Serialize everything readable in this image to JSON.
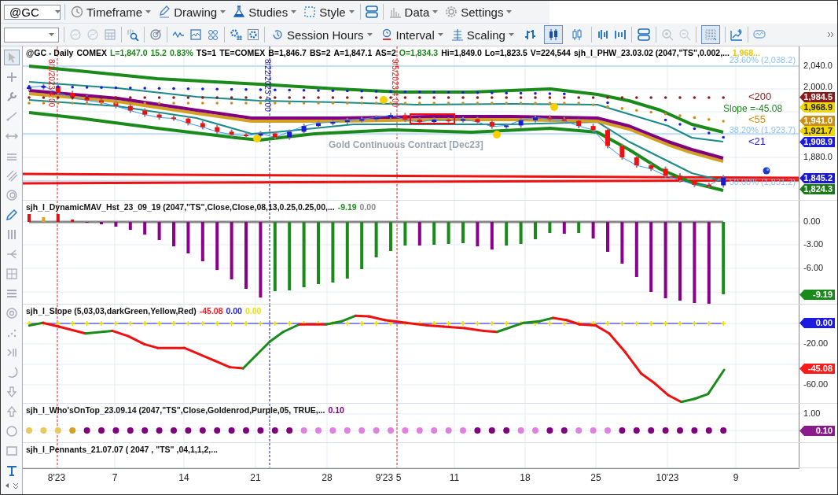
{
  "toolbar_1": {
    "symbol": "@GC",
    "menus": [
      {
        "label": "Timeframe"
      },
      {
        "label": "Drawing"
      },
      {
        "label": "Studies"
      },
      {
        "label": "Style"
      },
      {
        "label": "Data"
      },
      {
        "label": "Settings"
      }
    ]
  },
  "toolbar_2": {
    "menus": [
      {
        "label": "Session Hours"
      },
      {
        "label": "Interval"
      },
      {
        "label": "Scaling"
      }
    ],
    "chart_styles": [
      {
        "selected": false
      },
      {
        "selected": true
      },
      {
        "selected": false
      }
    ],
    "grid": {
      "on": true
    }
  },
  "tools": [
    {
      "selected": true
    },
    {
      "selected": false
    },
    {
      "selected": false
    },
    {
      "selected": false
    },
    {
      "selected": false
    },
    {
      "selected": false
    },
    {
      "selected": false
    },
    {
      "selected": false
    },
    {
      "selected": false
    },
    {
      "selected": false
    },
    {
      "selected": false
    },
    {
      "selected": false
    },
    {
      "selected": false
    },
    {
      "selected": false
    },
    {
      "selected": false
    },
    {
      "selected": false
    },
    {
      "selected": false
    },
    {
      "selected": false
    },
    {
      "selected": false
    },
    {
      "selected": false
    },
    {
      "selected": false
    },
    {
      "selected": false
    }
  ],
  "price_pane": {
    "header": [
      {
        "text": "@GC - Daily",
        "color": "#000000"
      },
      {
        "text": "COMEX",
        "color": "#000000"
      },
      {
        "text": "L=1,847.0",
        "color": "#1a8a1a"
      },
      {
        "text": "15.2",
        "color": "#1a8a1a"
      },
      {
        "text": "0.83%",
        "color": "#1a8a1a"
      },
      {
        "text": "TS=1",
        "color": "#000000"
      },
      {
        "text": "TE=COMEX",
        "color": "#000000"
      },
      {
        "text": "B=1,846.7",
        "color": "#000000"
      },
      {
        "text": "BS=2",
        "color": "#000000"
      },
      {
        "text": "A=1,847.1",
        "color": "#000000"
      },
      {
        "text": "AS=2",
        "color": "#000000"
      },
      {
        "text": "O=1,834.3",
        "color": "#1a8a1a"
      },
      {
        "text": "Hi=1,849.0",
        "color": "#000000"
      },
      {
        "text": "Lo=1,823.5",
        "color": "#000000"
      },
      {
        "text": "V=224,544",
        "color": "#000000"
      },
      {
        "text": "sjh_I_PHW_23.03.02 (2047,\"TS\",0.002,...",
        "color": "#000000"
      },
      {
        "text": "1,968...",
        "color": "#e8c800"
      }
    ],
    "date_markers": [
      {
        "text": "8/1/2023 4:00",
        "color": "#e02020"
      },
      {
        "text": "8/22/2023 4:00",
        "color": "#1a1a8a"
      },
      {
        "text": "9/5/2023 4:00",
        "color": "#e02020"
      }
    ],
    "watermark": "Gold Continuous Contract [Dec23]",
    "fib_levels": [
      "23.60% (2,038.2)",
      "38.20% (1,923.7)",
      "50.00% (1,831.2)"
    ],
    "line_labels": [
      {
        "text": "<200",
        "color": "#8b1a1a"
      },
      {
        "text": "Slope =-45.08",
        "color": "#1a8a1a"
      },
      {
        "text": "<55",
        "color": "#cc8e1a"
      },
      {
        "text": "<21",
        "color": "#1a1ae0"
      }
    ],
    "axis_labels": [
      "2,040.0",
      "2,000.0",
      "1,880.0"
    ],
    "tags": [
      {
        "text": "1,984.5",
        "color": "#8b1a1a"
      },
      {
        "text": "1,968.9",
        "color": "#f0d800"
      },
      {
        "text": "1,941.0",
        "color": "#cc8e1a"
      },
      {
        "text": "1,921.7",
        "color": "#f0d800"
      },
      {
        "text": "1,908.9",
        "color": "#1a1ae0"
      },
      {
        "text": "1,845.2",
        "color": "#1a1ad0"
      },
      {
        "text": "1,824.3",
        "color": "#1a7a1a"
      }
    ]
  },
  "histogram_pane": {
    "title": "sjh_I_DynamicMAV_Hst_23_09_19 (2047,\"TS\",Close,Close,08,13,0.25,0.25,00,...",
    "readings": [
      {
        "text": "-9.19",
        "color": "#1a8a1a"
      },
      {
        "text": "0.00",
        "color": "#888888"
      }
    ],
    "axis_labels": [
      "0.00",
      "-3.00",
      "-6.00"
    ],
    "tags": [
      {
        "text": "-9.19",
        "color": "#1a8a1a"
      }
    ]
  },
  "slope_pane": {
    "title": "sjh_I_Slope (5,03,03,darkGreen,Yellow,Red)",
    "readings": [
      {
        "text": "-45.08",
        "color": "#ff1a1a"
      },
      {
        "text": "0.00",
        "color": "#1a1ae0"
      },
      {
        "text": "0.00",
        "color": "#f0e000"
      }
    ],
    "axis_labels": [
      "-20.00",
      "-60.00"
    ],
    "tags": [
      {
        "text": "0.00",
        "color": "#1a1ae0"
      },
      {
        "text": "-45.08",
        "color": "#ff1a1a"
      }
    ]
  },
  "whos_on_top_pane": {
    "title": "sjh_I_Who'sOnTop_23.09.14 (2047,\"TS\",Close,Goldenrod,Purple,05,  TRUE,...",
    "readings": [
      {
        "text": "0.10",
        "color": "#800080"
      }
    ],
    "axis_labels": [
      "1.00"
    ],
    "tags": [
      {
        "text": "0.10",
        "color": "#8b1a8b"
      }
    ]
  },
  "pennants_pane": {
    "title": "sjh_I_Pennants_21.07.07 (  2047 ,  \"TS\" ,04,1,1,2,..."
  },
  "x_axis": {
    "labels": [
      "8'23",
      "7",
      "14",
      "21",
      "28",
      "9'23",
      "5",
      "11",
      "18",
      "25",
      "10'23",
      "9"
    ]
  }
}
